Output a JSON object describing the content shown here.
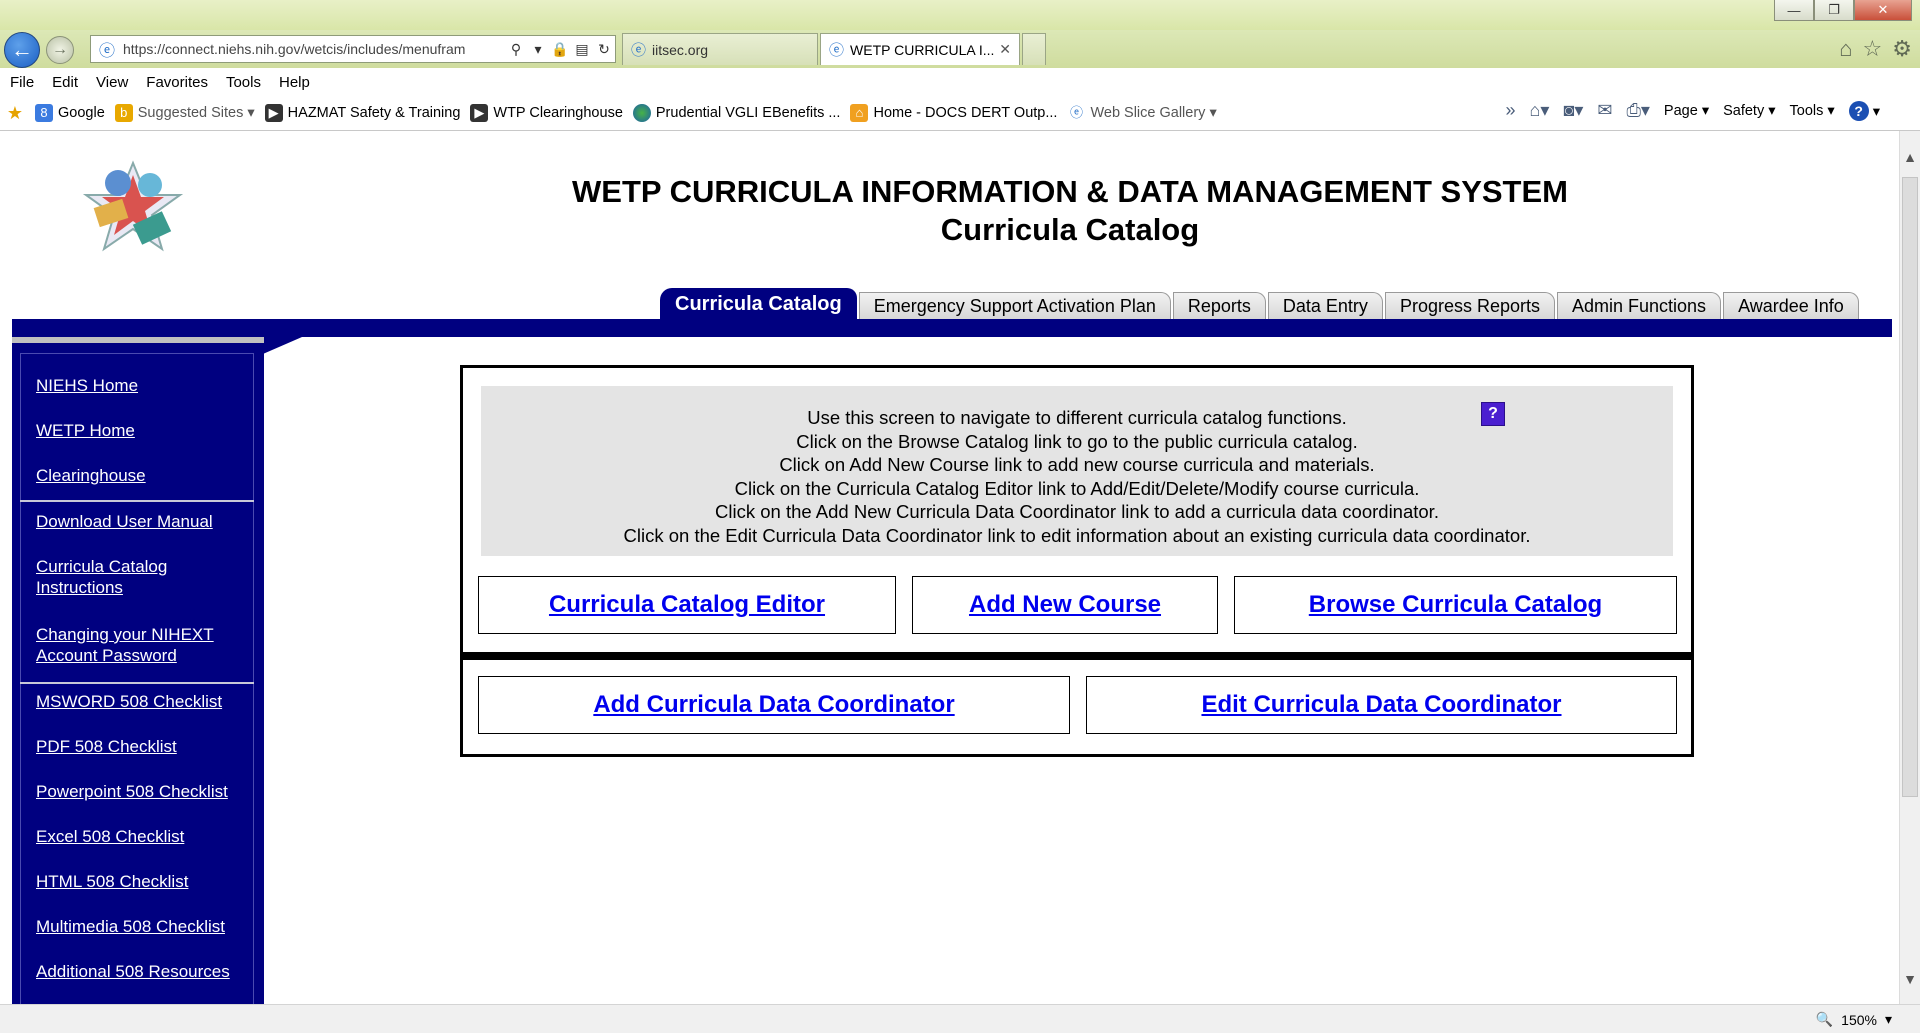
{
  "browser": {
    "address_url": "https://connect.niehs.nih.gov/wetcis/includes/menufram",
    "tabs": [
      {
        "label": "iitsec.org"
      },
      {
        "label": "WETP CURRICULA I..."
      }
    ],
    "menu": [
      "File",
      "Edit",
      "View",
      "Favorites",
      "Tools",
      "Help"
    ],
    "favorites": [
      {
        "label": "Google",
        "icon": "google-icon"
      },
      {
        "label": "Suggested Sites ▾",
        "icon": "bing-icon"
      },
      {
        "label": "HAZMAT Safety & Training",
        "icon": "page-icon"
      },
      {
        "label": "WTP Clearinghouse",
        "icon": "page-icon"
      },
      {
        "label": "Prudential VGLI  EBenefits ...",
        "icon": "globe-icon"
      },
      {
        "label": "Home - DOCS DERT Outp...",
        "icon": "sharepoint-icon"
      },
      {
        "label": "Web Slice Gallery ▾",
        "icon": "ie-icon"
      }
    ],
    "commands": [
      "Page ▾",
      "Safety ▾",
      "Tools ▾"
    ],
    "zoom": "150%"
  },
  "header": {
    "title": "WETP CURRICULA INFORMATION & DATA MANAGEMENT SYSTEM",
    "subtitle": "Curricula Catalog"
  },
  "nav_tabs": [
    {
      "label": "Curricula Catalog",
      "active": true
    },
    {
      "label": "Emergency Support Activation Plan"
    },
    {
      "label": "Reports"
    },
    {
      "label": "Data Entry"
    },
    {
      "label": "Progress Reports"
    },
    {
      "label": "Admin Functions"
    },
    {
      "label": "Awardee Info"
    }
  ],
  "sidebar": {
    "links": [
      "NIEHS Home",
      "WETP Home",
      "Clearinghouse",
      "Download User Manual",
      "Curricula Catalog Instructions",
      "Changing your NIHEXT Account Password",
      "MSWORD 508 Checklist",
      "PDF 508 Checklist",
      "Powerpoint 508 Checklist",
      "Excel 508 Checklist",
      "HTML 508 Checklist",
      "Multimedia 508 Checklist",
      "Additional 508 Resources"
    ]
  },
  "instructions": [
    "Use this screen to navigate to different curricula catalog functions.",
    "Click on the Browse Catalog link to go to the public curricula catalog.",
    "Click on Add New Course link to add new course curricula and materials.",
    "Click on the Curricula Catalog Editor link to Add/Edit/Delete/Modify course curricula.",
    "Click on the Add New Curricula Data Coordinator link to add a curricula data coordinator.",
    "Click on the Edit Curricula Data Coordinator link to edit information about an existing curricula data coordinator."
  ],
  "help_icon_label": "?",
  "actions": {
    "editor": "Curricula Catalog Editor",
    "add_course": "Add New Course",
    "browse": "Browse Curricula Catalog",
    "add_coordinator": "Add Curricula Data Coordinator",
    "edit_coordinator": "Edit Curricula Data Coordinator"
  }
}
